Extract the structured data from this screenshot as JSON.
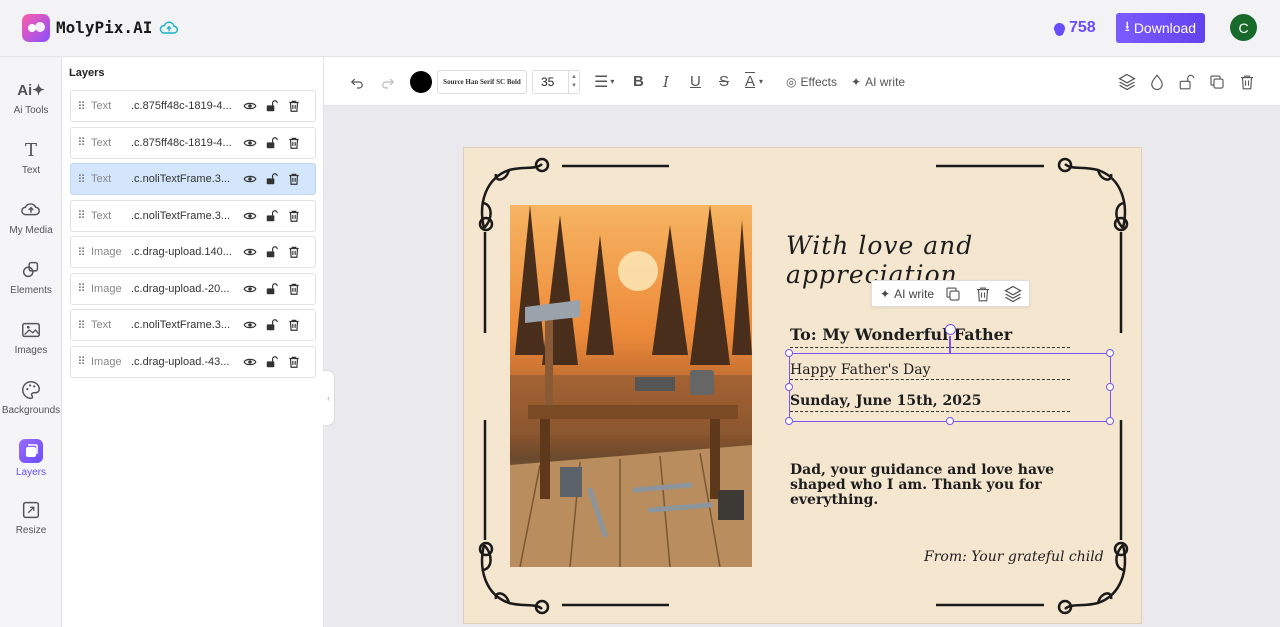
{
  "app": {
    "name": "MolyPix.AI",
    "credits": "758",
    "download_label": "Download",
    "avatar_initial": "C",
    "brand_color": "#6a4cff"
  },
  "sidebar": {
    "items": [
      {
        "label": "Ai Tools",
        "icon": "ai-sparkle-icon"
      },
      {
        "label": "Text",
        "icon": "text-icon"
      },
      {
        "label": "My Media",
        "icon": "upload-cloud-icon"
      },
      {
        "label": "Elements",
        "icon": "shapes-icon"
      },
      {
        "label": "Images",
        "icon": "image-icon"
      },
      {
        "label": "Backgrounds",
        "icon": "palette-icon"
      },
      {
        "label": "Layers",
        "icon": "layers-icon",
        "active": true
      },
      {
        "label": "Resize",
        "icon": "resize-icon"
      }
    ]
  },
  "layers": {
    "title": "Layers",
    "rows": [
      {
        "type": "Text",
        "name": ".c.875ff48c-1819-4...",
        "selected": false
      },
      {
        "type": "Text",
        "name": ".c.875ff48c-1819-4...",
        "selected": false
      },
      {
        "type": "Text",
        "name": ".c.noliTextFrame.3...",
        "selected": true
      },
      {
        "type": "Text",
        "name": ".c.noliTextFrame.3...",
        "selected": false
      },
      {
        "type": "Image",
        "name": ".c.drag-upload.140...",
        "selected": false
      },
      {
        "type": "Image",
        "name": ".c.drag-upload.-20...",
        "selected": false
      },
      {
        "type": "Text",
        "name": ".c.noliTextFrame.3...",
        "selected": false
      },
      {
        "type": "Image",
        "name": ".c.drag-upload.-43...",
        "selected": false
      }
    ]
  },
  "toolbar": {
    "font_name": "Source Han Serif SC Bold",
    "font_size": "35",
    "text_color": "#000000",
    "effects_label": "Effects",
    "ai_write_label": "AI write"
  },
  "card": {
    "title": "With love and appreciation",
    "to_line": "To: My Wonderful Father",
    "occasion": "Happy Father's Day",
    "date": "Sunday, June 15th, 2025",
    "message": "Dad, your guidance and love have shaped who I am. Thank you for everything.",
    "signature": "From: Your grateful child",
    "background_color": "#f5e6d0"
  },
  "float_toolbar": {
    "ai_write_label": "AI write"
  }
}
